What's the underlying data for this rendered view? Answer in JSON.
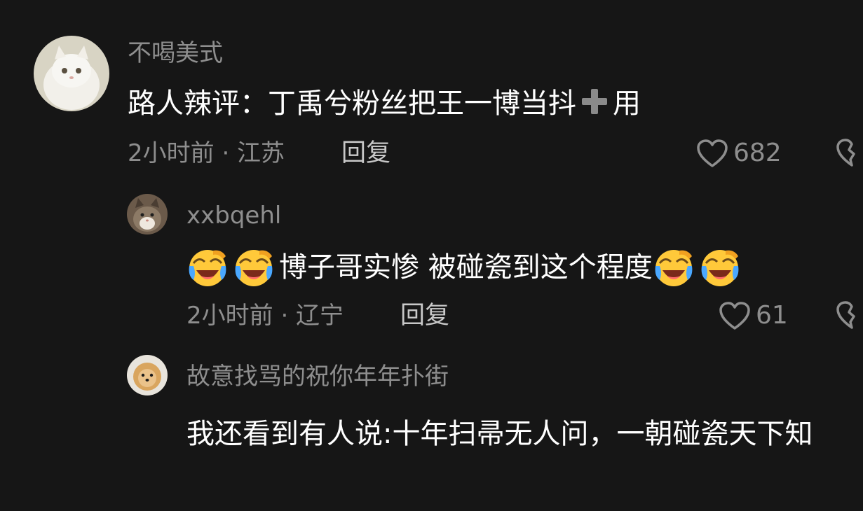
{
  "comments": [
    {
      "username": "不喝美式",
      "content_before_icon": "路人辣评：丁禹兮粉丝把王一博当抖",
      "content_after_icon": "用",
      "inline_icon": "plus-icon",
      "meta": "2小时前 · 江苏",
      "reply_label": "回复",
      "likes": "682"
    },
    {
      "username": "xxbqehl",
      "content": "博子哥实惨 被碰瓷到这个程度",
      "leading_emoji": [
        "laughing-crying-face-icon",
        "laughing-crying-face-icon"
      ],
      "trailing_emoji": [
        "laughing-crying-face-icon",
        "laughing-crying-face-icon"
      ],
      "meta": "2小时前 · 辽宁",
      "reply_label": "回复",
      "likes": "61"
    },
    {
      "username": "故意找骂的祝你年年扑街",
      "content": "我还看到有人说:十年扫帚无人问，一朝碰瓷天下知"
    }
  ],
  "colors": {
    "background": "#161616",
    "secondary_text": "#8e8e8e",
    "primary_text": "#ffffff"
  }
}
